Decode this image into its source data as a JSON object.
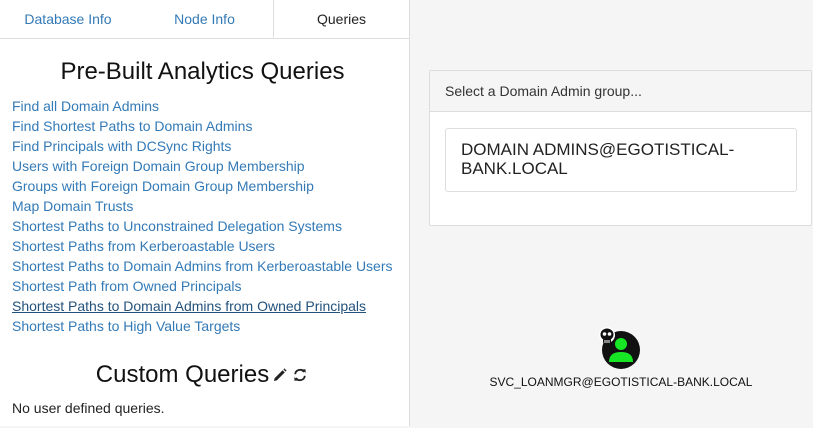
{
  "tabs": [
    {
      "label": "Database Info"
    },
    {
      "label": "Node Info"
    },
    {
      "label": "Queries",
      "active": true
    }
  ],
  "prebuilt": {
    "title": "Pre-Built Analytics Queries",
    "queries": [
      "Find all Domain Admins",
      "Find Shortest Paths to Domain Admins",
      "Find Principals with DCSync Rights",
      "Users with Foreign Domain Group Membership",
      "Groups with Foreign Domain Group Membership",
      "Map Domain Trusts",
      "Shortest Paths to Unconstrained Delegation Systems",
      "Shortest Paths from Kerberoastable Users",
      "Shortest Paths to Domain Admins from Kerberoastable Users",
      "Shortest Path from Owned Principals",
      "Shortest Paths to Domain Admins from Owned Principals",
      "Shortest Paths to High Value Targets"
    ]
  },
  "custom": {
    "title": "Custom Queries",
    "empty_text": "No user defined queries.",
    "icons": [
      "pencil-icon",
      "refresh-icon"
    ]
  },
  "domain_select": {
    "header": "Select a Domain Admin group...",
    "option": "DOMAIN ADMINS@EGOTISTICAL-BANK.LOCAL"
  },
  "graph": {
    "node_label": "SVC_LOANMGR@EGOTISTICAL-BANK.LOCAL",
    "node_icon": "owned-user-icon",
    "node_color": "#17e625"
  },
  "colors": {
    "link": "#337ab7",
    "border": "#dddddd"
  }
}
